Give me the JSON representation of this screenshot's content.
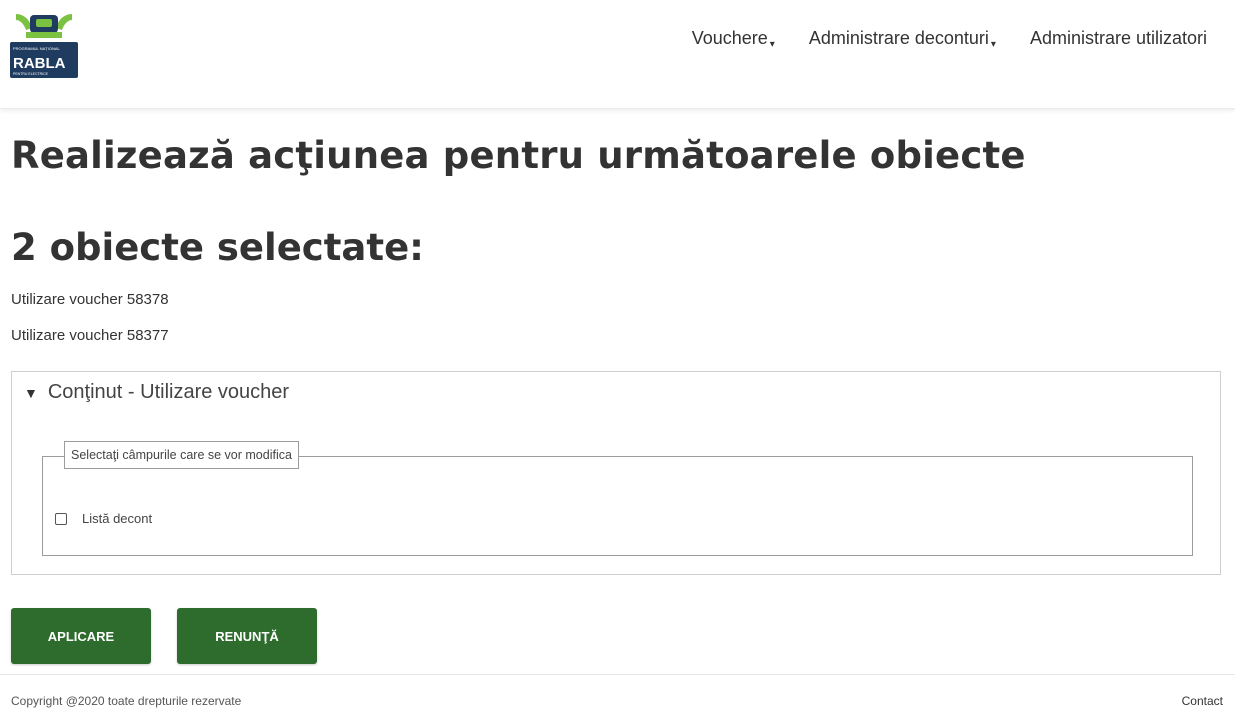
{
  "logo": {
    "top_text": "PROGRAMUL NAȚIONAL",
    "name": "RABLA",
    "tagline": "PENTRU ELECTRICE"
  },
  "nav": {
    "items": [
      {
        "label": "Vouchere",
        "caret": "▾"
      },
      {
        "label": "Administrare deconturi",
        "caret": "▾"
      },
      {
        "label": "Administrare utilizatori",
        "caret": ""
      }
    ]
  },
  "main": {
    "title": "Realizează acţiunea pentru următoarele obiecte",
    "selected_heading": "2 obiecte selectate:",
    "selected_items": [
      "Utilizare voucher 58378",
      "Utilizare voucher 58377"
    ],
    "details": {
      "triangle": "▼",
      "summary": "Conţinut - Utilizare voucher",
      "legend": "Selectaţi câmpurile care se vor modifica",
      "checkbox_label": "Listă decont"
    },
    "buttons": {
      "apply": "APLICARE",
      "cancel": "RENUNŢĂ"
    }
  },
  "footer": {
    "copyright": "Copyright @2020 toate drepturile rezervate",
    "contact": "Contact"
  },
  "colors": {
    "button": "#2e6c2e",
    "logo_navy": "#1f3b60",
    "logo_green": "#7cc242"
  }
}
